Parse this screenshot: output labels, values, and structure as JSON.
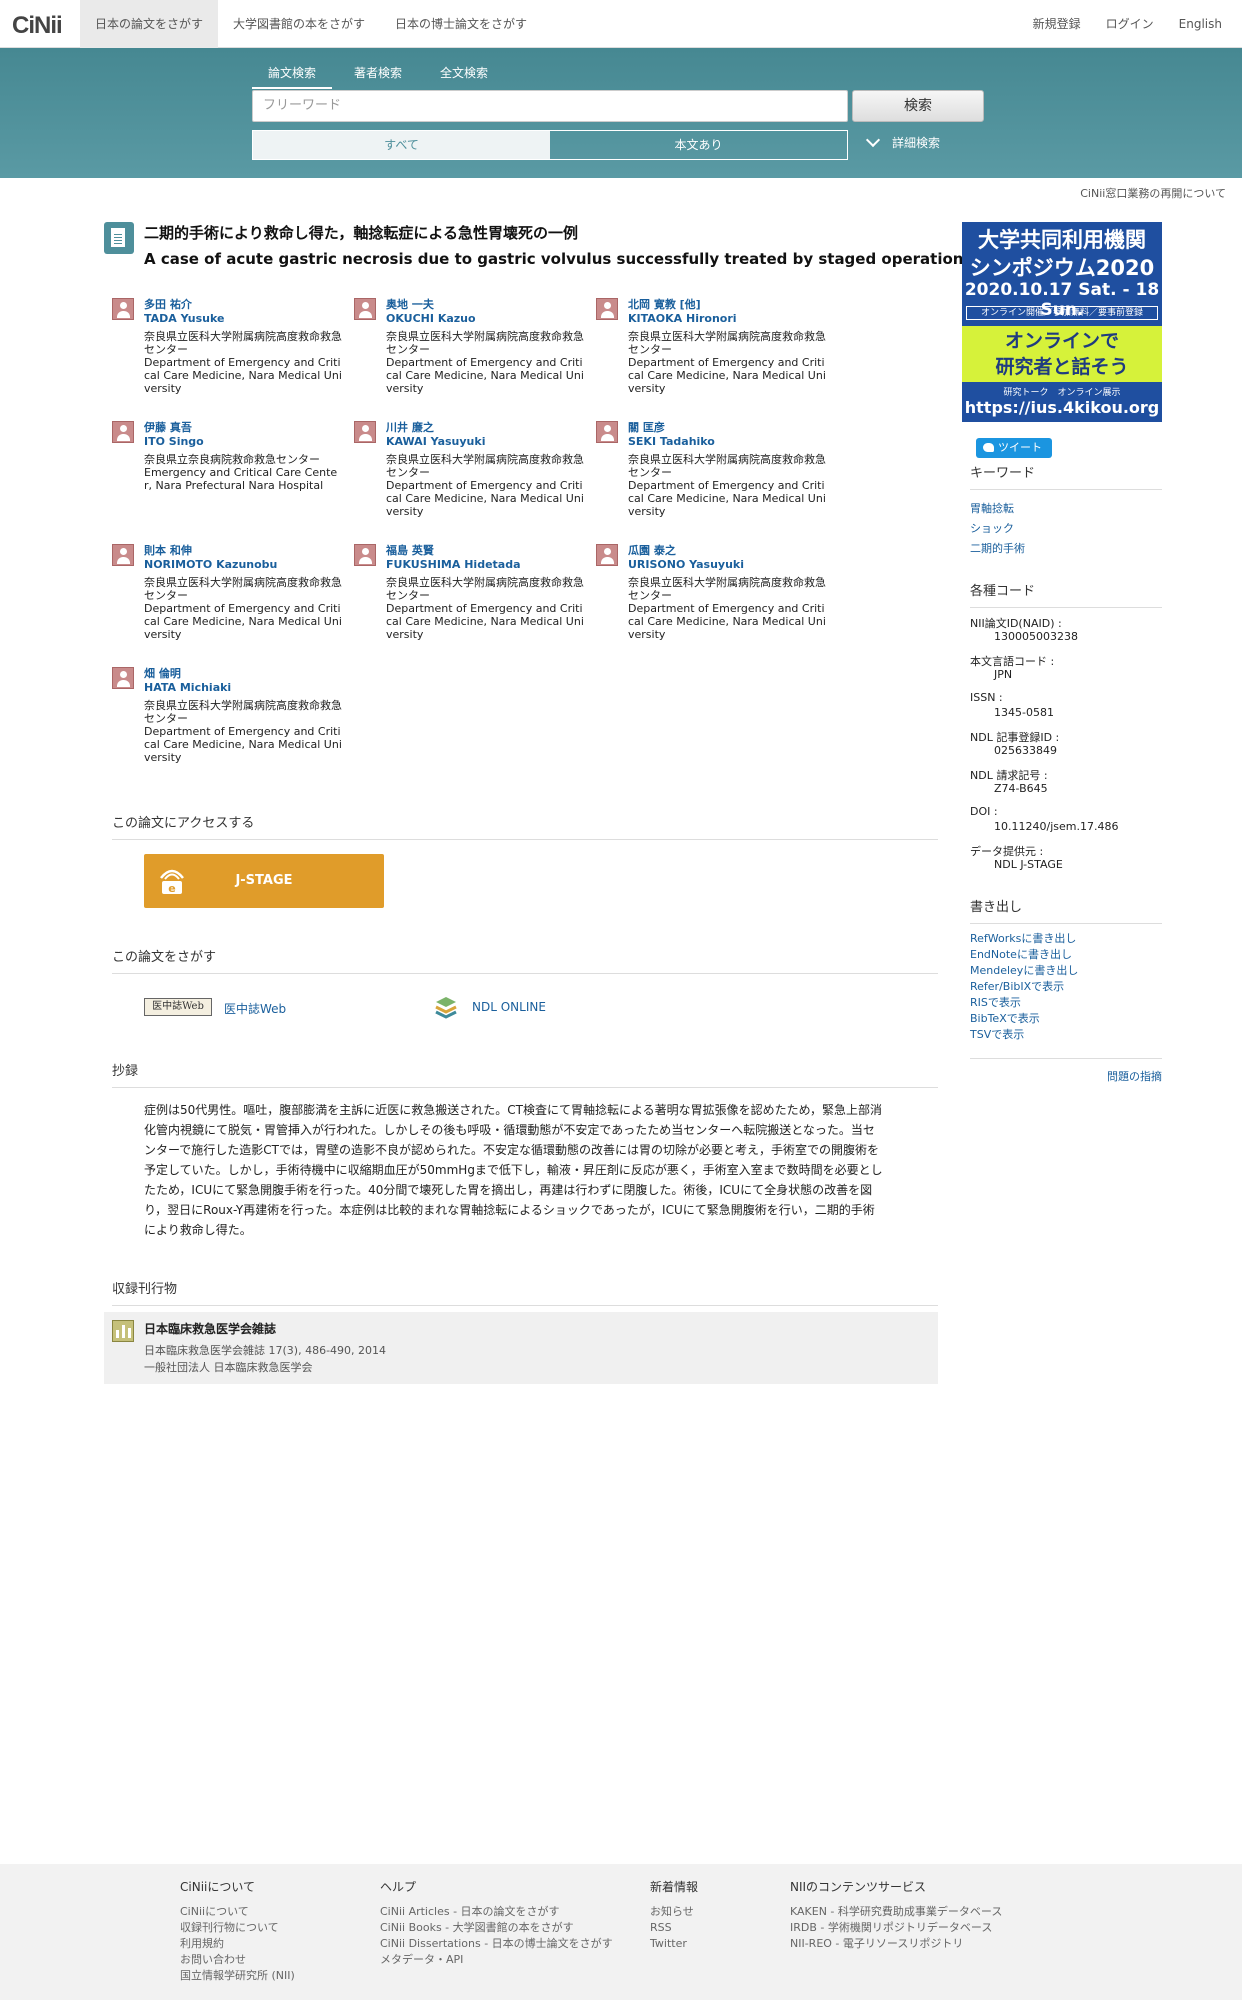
{
  "header": {
    "logo_text": "CiNii",
    "nav": [
      "日本の論文をさがす",
      "大学図書館の本をさがす",
      "日本の博士論文をさがす"
    ],
    "right": [
      "新規登録",
      "ログイン",
      "English"
    ]
  },
  "search": {
    "tabs": [
      "論文検索",
      "著者検索",
      "全文検索"
    ],
    "placeholder": "フリーワード",
    "button": "検索",
    "filters": [
      "すべて",
      "本文あり"
    ],
    "advanced": "詳細検索"
  },
  "notice": "CiNii窓口業務の再開について",
  "article": {
    "title_ja": "二期的手術により救命し得た，軸捻転症による急性胃壊死の一例",
    "title_en": "A case of acute gastric necrosis due to gastric volvulus successfully treated by staged operation",
    "authors": [
      {
        "name_ja": "多田 祐介",
        "name_en": "TADA Yusuke",
        "aff": "奈良県立医科大学附属病院高度救命救急センター",
        "aff_en": "Department of Emergency and Critical Care Medicine, Nara Medical University"
      },
      {
        "name_ja": "奥地 一夫",
        "name_en": "OKUCHI Kazuo",
        "aff": "奈良県立医科大学附属病院高度救命救急センター",
        "aff_en": "Department of Emergency and Critical Care Medicine, Nara Medical University"
      },
      {
        "name_ja": "北岡 寛教 [他]",
        "name_en": "KITAOKA Hironori",
        "aff": "奈良県立医科大学附属病院高度救命救急センター",
        "aff_en": "Department of Emergency and Critical Care Medicine, Nara Medical University"
      },
      {
        "name_ja": "伊藤 真吾",
        "name_en": "ITO Singo",
        "aff": "奈良県立奈良病院救命救急センター",
        "aff_en": "Emergency and Critical Care Center, Nara Prefectural Nara Hospital"
      },
      {
        "name_ja": "川井 廉之",
        "name_en": "KAWAI Yasuyuki",
        "aff": "奈良県立医科大学附属病院高度救命救急センター",
        "aff_en": "Department of Emergency and Critical Care Medicine, Nara Medical University"
      },
      {
        "name_ja": "關 匡彦",
        "name_en": "SEKI Tadahiko",
        "aff": "奈良県立医科大学附属病院高度救命救急センター",
        "aff_en": "Department of Emergency and Critical Care Medicine, Nara Medical University"
      },
      {
        "name_ja": "則本 和伸",
        "name_en": "NORIMOTO Kazunobu",
        "aff": "奈良県立医科大学附属病院高度救命救急センター",
        "aff_en": "Department of Emergency and Critical Care Medicine, Nara Medical University"
      },
      {
        "name_ja": "福島 英賢",
        "name_en": "FUKUSHIMA Hidetada",
        "aff": "奈良県立医科大学附属病院高度救命救急センター",
        "aff_en": "Department of Emergency and Critical Care Medicine, Nara Medical University"
      },
      {
        "name_ja": "瓜園 泰之",
        "name_en": "URISONO Yasuyuki",
        "aff": "奈良県立医科大学附属病院高度救命救急センター",
        "aff_en": "Department of Emergency and Critical Care Medicine, Nara Medical University"
      },
      {
        "name_ja": "畑 倫明",
        "name_en": "HATA Michiaki",
        "aff": "奈良県立医科大学附属病院高度救命救急センター",
        "aff_en": "Department of Emergency and Critical Care Medicine, Nara Medical University"
      }
    ],
    "access_heading": "この論文にアクセスする",
    "jstage_label": "J-STAGE",
    "find_heading": "この論文をさがす",
    "ichushi_badge": "医中誌Web",
    "ichushi_link": "医中誌Web",
    "ndl_link": "NDL ONLINE",
    "abstract_heading": "抄録",
    "abstract": "症例は50代男性。嘔吐，腹部膨満を主訴に近医に救急搬送された。CT検査にて胃軸捻転による著明な胃拡張像を認めたため，緊急上部消化管内視鏡にて脱気・胃管挿入が行われた。しかしその後も呼吸・循環動態が不安定であったため当センターへ転院搬送となった。当センターで施行した造影CTでは，胃壁の造影不良が認められた。不安定な循環動態の改善には胃の切除が必要と考え，手術室での開腹術を予定していた。しかし，手術待機中に収縮期血圧が50mmHgまで低下し，輸液・昇圧剤に反応が悪く，手術室入室まで数時間を必要としたため，ICUにて緊急開腹手術を行った。40分間で壊死した胃を摘出し，再建は行わずに閉腹した。術後，ICUにて全身状態の改善を図り，翌日にRoux-Y再建術を行った。本症例は比較的まれな胃軸捻転によるショックであったが，ICUにて緊急開腹術を行い，二期的手術により救命し得た。",
    "journal_heading": "収録刊行物",
    "journal_title": "日本臨床救急医学会雑誌",
    "journal_vol": "日本臨床救急医学会雑誌 17(3), 486-490, 2014",
    "journal_pub": "一般社団法人 日本臨床救急医学会"
  },
  "sidebar": {
    "banner": {
      "line1": "大学共同利用機関",
      "line2": "シンポジウム2020",
      "date": "2020.10.17 Sat. - 18 Sun.",
      "strip": "オンライン開催／参加無料／要事前登録",
      "green1": "オンラインで",
      "green2": "研究者と話そう",
      "small": "研究トーク　オンライン展示",
      "url": "https://ius.4kikou.org"
    },
    "tweet": "ツイート",
    "keywords_heading": "キーワード",
    "keywords": [
      "胃軸捻転",
      "ショック",
      "二期的手術"
    ],
    "codes_heading": "各種コード",
    "codes": [
      {
        "label": "NII論文ID(NAID) :",
        "value": "130005003238"
      },
      {
        "label": "本文言語コード :",
        "value": "JPN"
      },
      {
        "label": "ISSN :",
        "value": "1345-0581"
      },
      {
        "label": "NDL 記事登録ID :",
        "value": "025633849"
      },
      {
        "label": "NDL 請求記号 :",
        "value": "Z74-B645"
      },
      {
        "label": "DOI :",
        "value": "10.11240/jsem.17.486"
      },
      {
        "label": "データ提供元 :",
        "value": "NDL  J-STAGE"
      }
    ],
    "export_heading": "書き出し",
    "exports": [
      "RefWorksに書き出し",
      "EndNoteに書き出し",
      "Mendeleyに書き出し",
      "Refer/BibIXで表示",
      "RISで表示",
      "BibTeXで表示",
      "TSVで表示"
    ],
    "report": "問題の指摘"
  },
  "footer": {
    "cols": [
      {
        "head": "CiNiiについて",
        "links": [
          "CiNiiについて",
          "収録刊行物について",
          "利用規約",
          "お問い合わせ",
          "国立情報学研究所 (NII)"
        ]
      },
      {
        "head": "ヘルプ",
        "links": [
          "CiNii Articles - 日本の論文をさがす",
          "CiNii Books - 大学図書館の本をさがす",
          "CiNii Dissertations - 日本の博士論文をさがす",
          "メタデータ・API"
        ]
      },
      {
        "head": "新着情報",
        "links": [
          "お知らせ",
          "RSS",
          "Twitter"
        ]
      },
      {
        "head": "NIIのコンテンツサービス",
        "links": [
          "KAKEN - 科学研究費助成事業データベース",
          "IRDB - 学術機関リポジトリデータベース",
          "NII-REO - 電子リソースリポジトリ"
        ]
      }
    ]
  }
}
